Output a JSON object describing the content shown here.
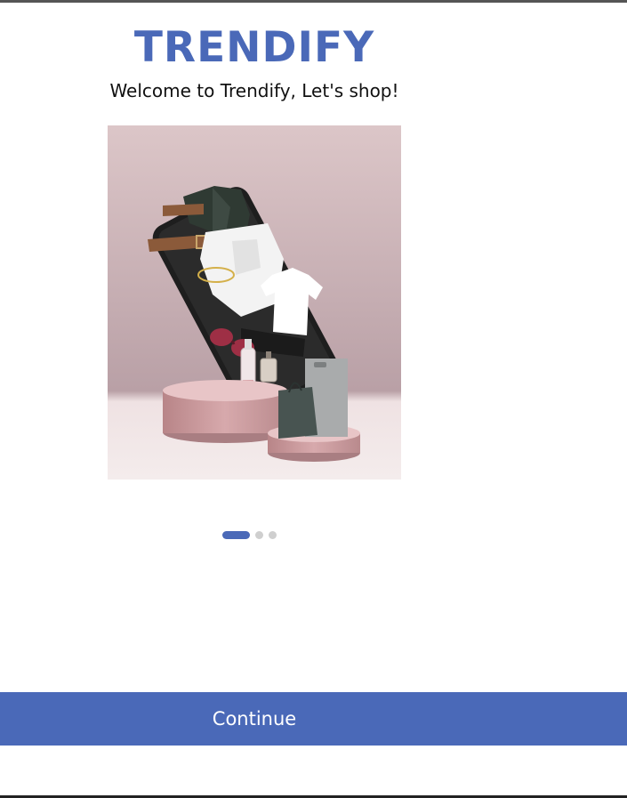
{
  "app": {
    "brand_title": "TRENDIFY",
    "welcome_text": "Welcome to Trendify, Let's shop!"
  },
  "hero": {
    "image_name": "shopping-phone-illustration"
  },
  "pager": {
    "total": 3,
    "active_index": 0
  },
  "actions": {
    "continue_label": "Continue"
  },
  "colors": {
    "accent": "#4a69b8",
    "inactive_dot": "#cfcfcf",
    "background": "#ffffff"
  }
}
